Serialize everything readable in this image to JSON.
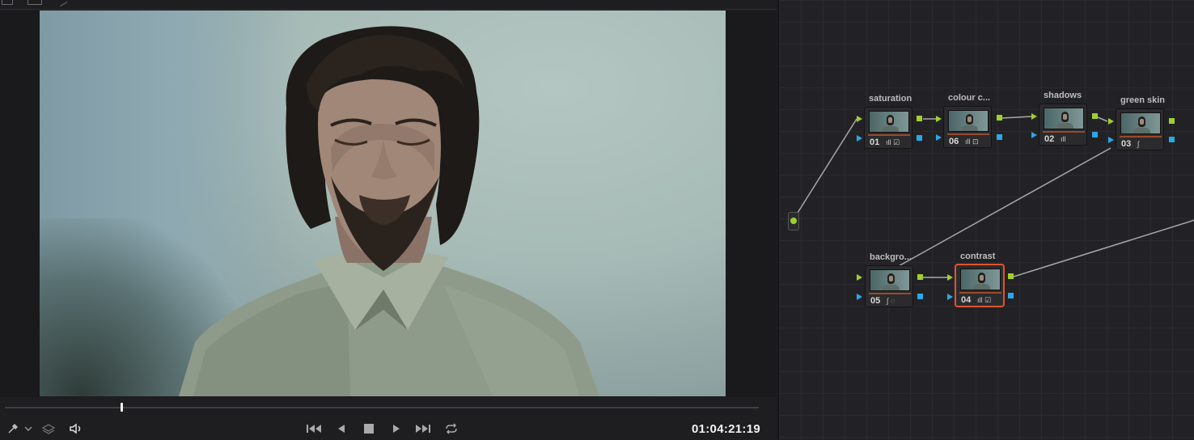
{
  "viewer": {
    "timecode": "01:04:21:19",
    "playhead_position": 0.155,
    "icons": {
      "picker": "eyedropper-icon",
      "picker_menu": "chevron-down-icon",
      "layers": "layers-icon",
      "audio": "speaker-icon",
      "jump_start": "skip-to-start-icon",
      "reverse": "play-reverse-icon",
      "stop": "stop-icon",
      "play": "play-icon",
      "jump_end": "skip-to-end-icon",
      "loop": "loop-icon"
    }
  },
  "node_editor": {
    "nodes": [
      {
        "id": "01",
        "label": "saturation",
        "tools": "ıll ☑",
        "selected": false
      },
      {
        "id": "06",
        "label": "colour c...",
        "tools": "ıll ⊡",
        "selected": false
      },
      {
        "id": "02",
        "label": "shadows",
        "tools": "ıll",
        "selected": false
      },
      {
        "id": "03",
        "label": "green skin",
        "tools": "∫",
        "selected": false
      },
      {
        "id": "05",
        "label": "backgro...",
        "tools": "∫ ◌",
        "selected": false
      },
      {
        "id": "04",
        "label": "contrast",
        "tools": "ıll ☑",
        "selected": true
      }
    ],
    "colors": {
      "rgb_port": "#9fd12a",
      "key_port": "#2aa8e8",
      "selected_outline": "#e0532e"
    }
  }
}
